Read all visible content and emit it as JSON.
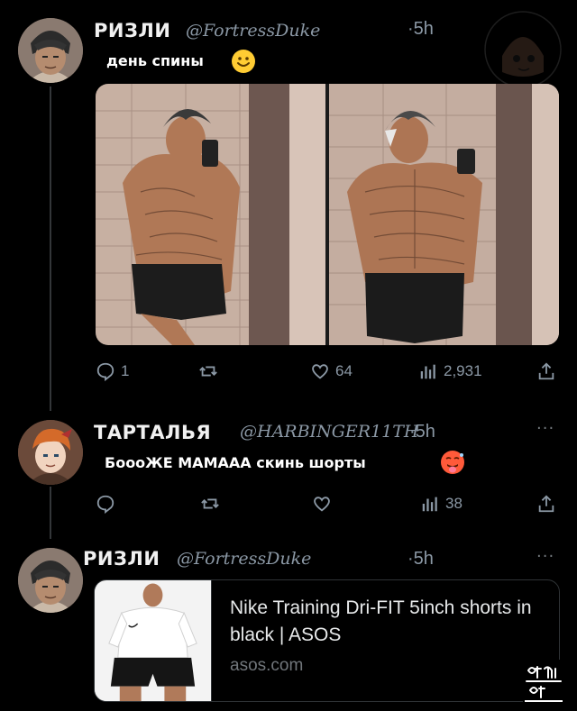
{
  "posts": [
    {
      "name": "РИЗЛИ",
      "handle": "@FortressDuke",
      "time": "·5h",
      "text": "день спины",
      "actions": {
        "replies": "1",
        "likes": "64",
        "views": "2,931"
      }
    },
    {
      "name": "ТАРТАЛЬЯ",
      "handle": "@HARBINGER11TH",
      "time": "·5h",
      "text": "БоооЖЕ МАМААА скинь шорты",
      "actions": {
        "views": "38"
      }
    },
    {
      "name": "РИЗЛИ",
      "handle": "@FortressDuke",
      "time": "·5h",
      "link_card": {
        "title": "Nike Training Dri-FIT 5inch shorts in black | ASOS",
        "domain": "asos.com"
      }
    }
  ],
  "more_label": "···",
  "icons": {
    "reply": "reply-icon",
    "retweet": "retweet-icon",
    "like": "heart-icon",
    "views": "views-icon",
    "share": "share-icon"
  },
  "colors": {
    "background": "#000000",
    "text": "#e7e9ea",
    "muted": "#8b98a5",
    "border": "#2f3336"
  }
}
